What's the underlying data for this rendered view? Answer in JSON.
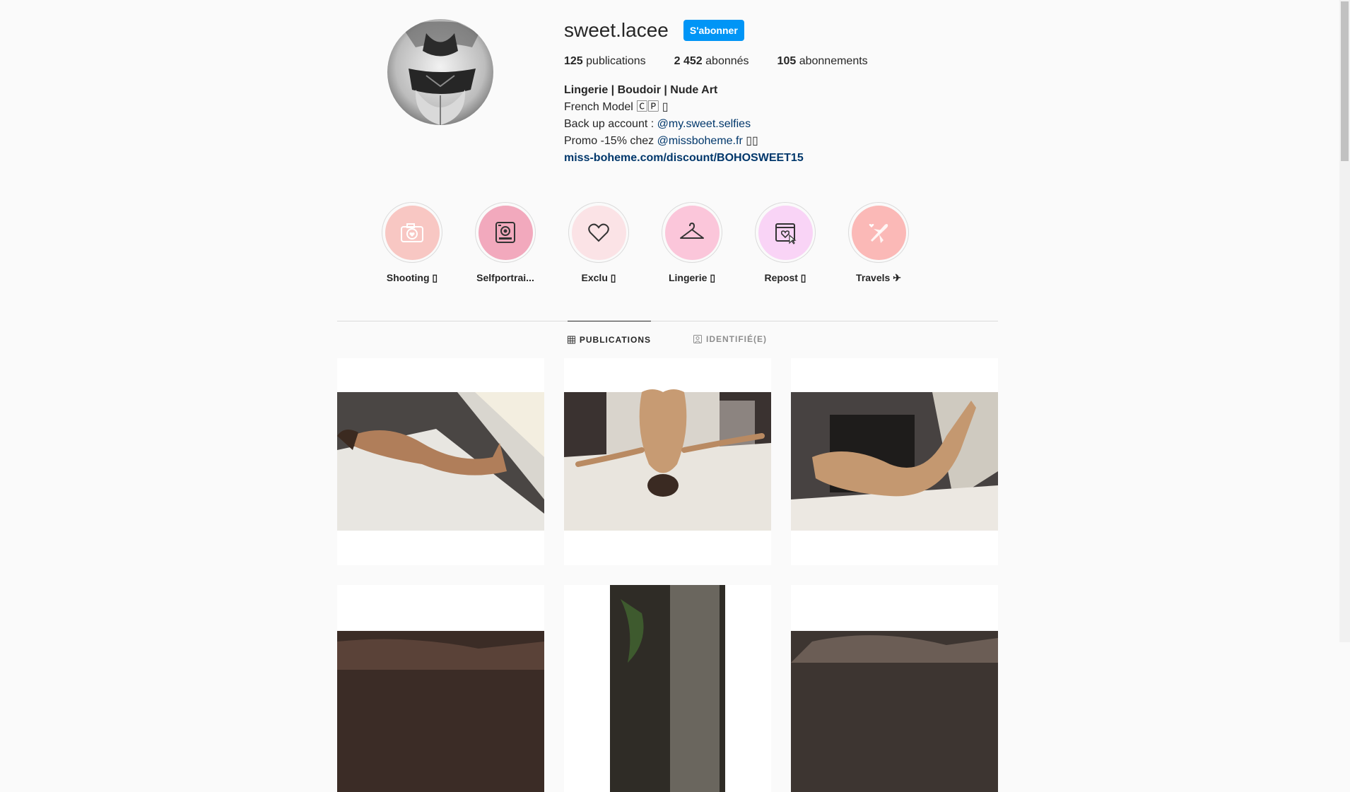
{
  "profile": {
    "username": "sweet.lacee",
    "follow_label": "S'abonner",
    "stats": {
      "posts_count": "125",
      "posts_label": "publications",
      "followers_count": "2 452",
      "followers_label": "abonnés",
      "following_count": "105",
      "following_label": "abonnements"
    },
    "bio": {
      "line1": "Lingerie | Boudoir | Nude Art",
      "line2": "French Model 🄲🄿 ▯",
      "line3_prefix": "Back up account : ",
      "line3_mention": "@my.sweet.selfies",
      "line4_prefix": "Promo -15% chez ",
      "line4_mention": "@missboheme.fr",
      "line4_suffix": " ▯▯",
      "link": "miss-boheme.com/discount/BOHOSWEET15"
    }
  },
  "highlights": [
    {
      "label": "Shooting ▯",
      "icon": "camera-heart-icon",
      "bg": "#f8c7c3"
    },
    {
      "label": "Selfportrai...",
      "icon": "polaroid-camera-icon",
      "bg": "#f2a9bd"
    },
    {
      "label": "Exclu ▯",
      "icon": "heart-icon",
      "bg": "#fbe3e6"
    },
    {
      "label": "Lingerie ▯",
      "icon": "hanger-icon",
      "bg": "#fbc6da"
    },
    {
      "label": "Repost ▯",
      "icon": "repost-window-icon",
      "bg": "#f9d4f6"
    },
    {
      "label": "Travels ✈",
      "icon": "airplane-heart-icon",
      "bg": "#fbb9b7"
    }
  ],
  "tabs": {
    "publications": "PUBLICATIONS",
    "tagged": "IDENTIFIÉ(E)"
  },
  "colors": {
    "accent": "#0095f6",
    "link": "#00376b",
    "text": "#262626",
    "muted": "#8e8e8e"
  }
}
